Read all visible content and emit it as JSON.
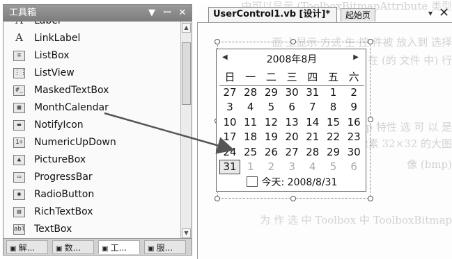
{
  "toolbox": {
    "title": "工具箱",
    "controls": {
      "dropdown": "▼",
      "pin": "ꟷ",
      "close": "✕"
    },
    "items": [
      {
        "label": "Label",
        "icon": "label-icon",
        "glyph": "A"
      },
      {
        "label": "LinkLabel",
        "icon": "linklabel-icon",
        "glyph": "A"
      },
      {
        "label": "ListBox",
        "icon": "listbox-icon",
        "glyph": "≡"
      },
      {
        "label": "ListView",
        "icon": "listview-icon",
        "glyph": "⋮⋮"
      },
      {
        "label": "MaskedTextBox",
        "icon": "maskedtextbox-icon",
        "glyph": "#_"
      },
      {
        "label": "MonthCalendar",
        "icon": "monthcalendar-icon",
        "glyph": "▦"
      },
      {
        "label": "NotifyIcon",
        "icon": "notifyicon-icon",
        "glyph": "▬"
      },
      {
        "label": "NumericUpDown",
        "icon": "numericupdown-icon",
        "glyph": "1÷"
      },
      {
        "label": "PictureBox",
        "icon": "picturebox-icon",
        "glyph": "▲"
      },
      {
        "label": "ProgressBar",
        "icon": "progressbar-icon",
        "glyph": "▭"
      },
      {
        "label": "RadioButton",
        "icon": "radiobutton-icon",
        "glyph": "◉"
      },
      {
        "label": "RichTextBox",
        "icon": "richtextbox-icon",
        "glyph": "▤"
      },
      {
        "label": "TextBox",
        "icon": "textbox-icon",
        "glyph": "abl"
      }
    ],
    "bottom_tabs": [
      {
        "label": "解...",
        "icon": "solution-explorer-icon"
      },
      {
        "label": "数...",
        "icon": "data-sources-icon"
      },
      {
        "label": "工...",
        "icon": "toolbox-tools-icon",
        "active": true
      },
      {
        "label": "服...",
        "icon": "server-explorer-icon"
      }
    ]
  },
  "designer": {
    "active_tab": "UserControl1.vb [设计]*",
    "start_tab": "起始页",
    "dropdown_glyph": "▾",
    "close_glyph": "✕",
    "background_lines": [
      "中可以显示 (ToolboxBitmapAttribute 类型",
      "面 上显示 方式 生 控 件被 放入到 选择",
      "在 (的 文件 中) 行",
      "控件 的 ToolboxBitmap 特性 选 可 以 是",
      "大小 的 Bitmap 像素 32×32 的大图",
      "像 (bmp)",
      "为 作 选 中 Toolbox 中 ToolboxBitmap"
    ]
  },
  "calendar": {
    "month_label": "2008年8月",
    "prev_glyph": "◀",
    "next_glyph": "▶",
    "weekdays": [
      "日",
      "一",
      "二",
      "三",
      "四",
      "五",
      "六"
    ],
    "weeks": [
      [
        {
          "d": "27",
          "dim": false
        },
        {
          "d": "28",
          "dim": false
        },
        {
          "d": "29",
          "dim": false
        },
        {
          "d": "30",
          "dim": false
        },
        {
          "d": "31",
          "dim": false
        },
        {
          "d": "1",
          "dim": false
        },
        {
          "d": "2",
          "dim": false
        }
      ],
      [
        {
          "d": "3",
          "dim": false
        },
        {
          "d": "4",
          "dim": false
        },
        {
          "d": "5",
          "dim": false
        },
        {
          "d": "6",
          "dim": false
        },
        {
          "d": "7",
          "dim": false
        },
        {
          "d": "8",
          "dim": false
        },
        {
          "d": "9",
          "dim": false
        }
      ],
      [
        {
          "d": "10",
          "dim": false
        },
        {
          "d": "11",
          "dim": false
        },
        {
          "d": "12",
          "dim": false
        },
        {
          "d": "13",
          "dim": false
        },
        {
          "d": "14",
          "dim": false
        },
        {
          "d": "15",
          "dim": false
        },
        {
          "d": "16",
          "dim": false
        }
      ],
      [
        {
          "d": "17",
          "dim": false
        },
        {
          "d": "18",
          "dim": false
        },
        {
          "d": "19",
          "dim": false
        },
        {
          "d": "20",
          "dim": false
        },
        {
          "d": "21",
          "dim": false
        },
        {
          "d": "22",
          "dim": false
        },
        {
          "d": "23",
          "dim": false
        }
      ],
      [
        {
          "d": "24",
          "dim": false
        },
        {
          "d": "25",
          "dim": false
        },
        {
          "d": "26",
          "dim": false
        },
        {
          "d": "27",
          "dim": false
        },
        {
          "d": "28",
          "dim": false
        },
        {
          "d": "29",
          "dim": false
        },
        {
          "d": "30",
          "dim": false
        }
      ],
      [
        {
          "d": "31",
          "dim": false,
          "today": true
        },
        {
          "d": "1",
          "dim": true
        },
        {
          "d": "2",
          "dim": true
        },
        {
          "d": "3",
          "dim": true
        },
        {
          "d": "4",
          "dim": true
        },
        {
          "d": "5",
          "dim": true
        },
        {
          "d": "6",
          "dim": true
        }
      ]
    ],
    "today_label": "今天: 2008/8/31"
  },
  "colors": {
    "panel_title": "#8a8a8a",
    "arrow": "#555555"
  }
}
